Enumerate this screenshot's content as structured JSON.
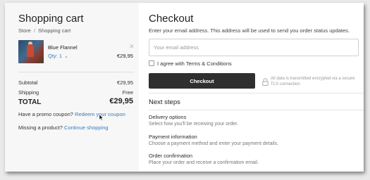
{
  "cart": {
    "title": "Shopping cart",
    "breadcrumb": [
      "Store",
      "Shopping cart"
    ],
    "item": {
      "name": "Blue Flannel",
      "qty": "Qty: 1",
      "price": "€29,95"
    },
    "subtotal_label": "Subtotal",
    "subtotal_value": "€29,95",
    "shipping_label": "Shipping",
    "shipping_value": "Free",
    "total_label": "TOTAL",
    "total_value": "€29,95",
    "promo_text": "Have a promo coupon?",
    "promo_link": "Redeem your coupon",
    "missing_text": "Missing a product?",
    "missing_link": "Continue shopping"
  },
  "checkout": {
    "title": "Checkout",
    "email_hint": "Enter your email address. This address will be used to send you order status updates.",
    "email_placeholder": "Your email address",
    "terms_label": "I agree with Terms & Conditions",
    "button_label": "Checkout",
    "secure_note": "All data is transmitted encrypted via a secure TLS connection",
    "next_steps_title": "Next steps",
    "steps": [
      {
        "title": "Delivery options",
        "desc": "Select how you'll be receiving your order."
      },
      {
        "title": "Payment information",
        "desc": "Choose a payment method and enter your payment details."
      },
      {
        "title": "Order confirmation",
        "desc": "Place your order and receive a confirmation email."
      }
    ]
  },
  "colors": {
    "link": "#3a7bbf",
    "button_bg": "#2f2f2f",
    "panel_bg": "#f7f7f7"
  },
  "icons": [
    "remove-icon",
    "chevron-down-icon",
    "lock-icon",
    "pointer-cursor-icon"
  ]
}
